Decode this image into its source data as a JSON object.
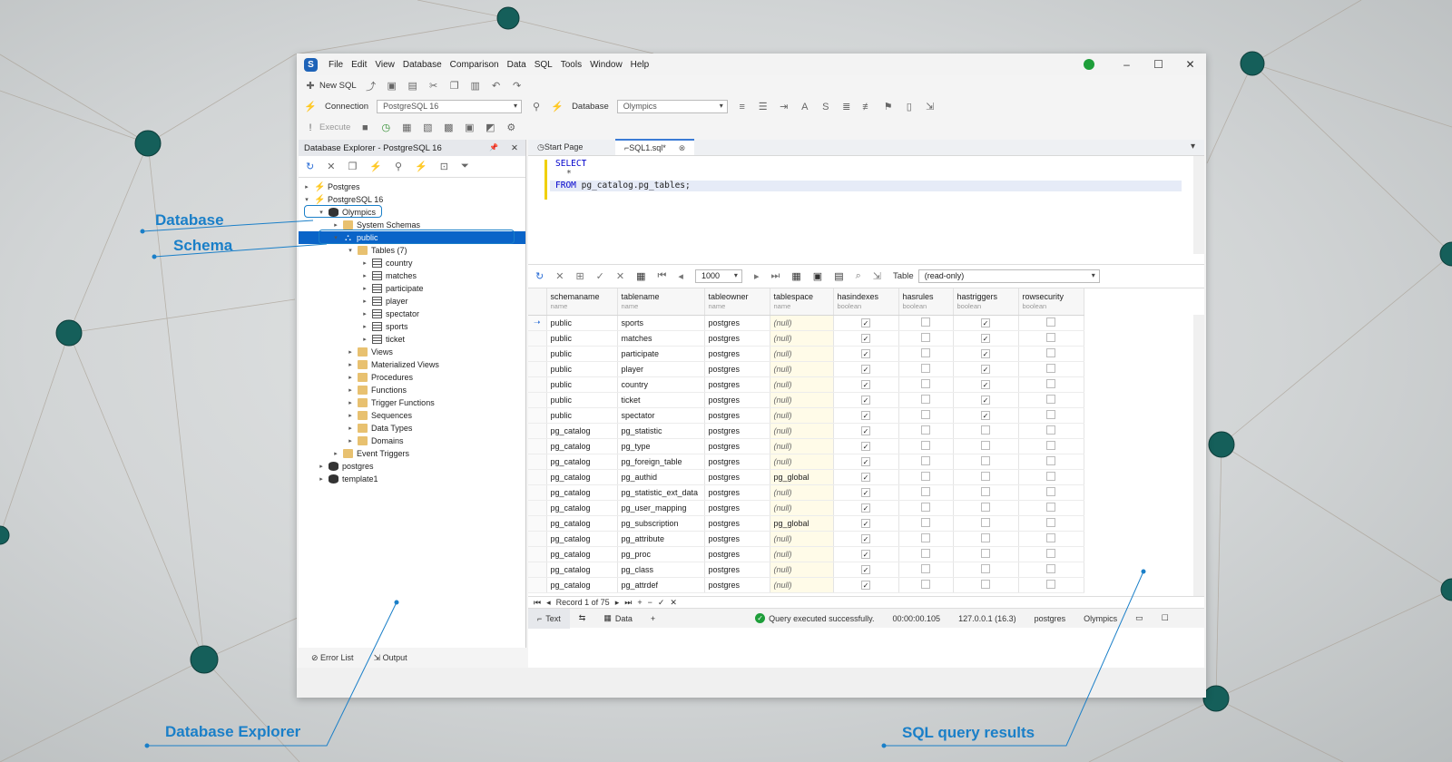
{
  "menu": [
    "File",
    "Edit",
    "View",
    "Database",
    "Comparison",
    "Data",
    "SQL",
    "Tools",
    "Window",
    "Help"
  ],
  "window_controls": [
    "–",
    "☐",
    "✕"
  ],
  "toolbar": {
    "new_sql": "New SQL",
    "connection_label": "Connection",
    "connection_value": "PostgreSQL 16",
    "database_label": "Database",
    "database_value": "Olympics",
    "execute": "Execute"
  },
  "explorer": {
    "title": "Database Explorer - PostgreSQL 16",
    "pin": "📌",
    "close": "✕"
  },
  "tree": [
    {
      "label": "Postgres",
      "level": 0,
      "icon": "plug",
      "arrow": "▸"
    },
    {
      "label": "PostgreSQL 16",
      "level": 0,
      "icon": "plug",
      "arrow": "▾"
    },
    {
      "label": "Olympics",
      "level": 1,
      "icon": "db",
      "arrow": "▾"
    },
    {
      "label": "System Schemas",
      "level": 2,
      "icon": "fold",
      "arrow": "▸"
    },
    {
      "label": "public",
      "level": 2,
      "icon": "schema",
      "arrow": "▾",
      "selected": true
    },
    {
      "label": "Tables (7)",
      "level": 3,
      "icon": "fold",
      "arrow": "▾"
    },
    {
      "label": "country",
      "level": 4,
      "icon": "tbl",
      "arrow": "▸"
    },
    {
      "label": "matches",
      "level": 4,
      "icon": "tbl",
      "arrow": "▸"
    },
    {
      "label": "participate",
      "level": 4,
      "icon": "tbl",
      "arrow": "▸"
    },
    {
      "label": "player",
      "level": 4,
      "icon": "tbl",
      "arrow": "▸"
    },
    {
      "label": "spectator",
      "level": 4,
      "icon": "tbl",
      "arrow": "▸"
    },
    {
      "label": "sports",
      "level": 4,
      "icon": "tbl",
      "arrow": "▸"
    },
    {
      "label": "ticket",
      "level": 4,
      "icon": "tbl",
      "arrow": "▸"
    },
    {
      "label": "Views",
      "level": 3,
      "icon": "fold",
      "arrow": "▸"
    },
    {
      "label": "Materialized Views",
      "level": 3,
      "icon": "fold",
      "arrow": "▸"
    },
    {
      "label": "Procedures",
      "level": 3,
      "icon": "fold",
      "arrow": "▸"
    },
    {
      "label": "Functions",
      "level": 3,
      "icon": "fold",
      "arrow": "▸"
    },
    {
      "label": "Trigger Functions",
      "level": 3,
      "icon": "fold",
      "arrow": "▸"
    },
    {
      "label": "Sequences",
      "level": 3,
      "icon": "fold",
      "arrow": "▸"
    },
    {
      "label": "Data Types",
      "level": 3,
      "icon": "fold",
      "arrow": "▸"
    },
    {
      "label": "Domains",
      "level": 3,
      "icon": "fold",
      "arrow": "▸"
    },
    {
      "label": "Event Triggers",
      "level": 2,
      "icon": "fold",
      "arrow": "▸"
    },
    {
      "label": "postgres",
      "level": 1,
      "icon": "db",
      "arrow": "▸"
    },
    {
      "label": "template1",
      "level": 1,
      "icon": "db",
      "arrow": "▸"
    }
  ],
  "bottom_tabs": {
    "error_list": "Error List",
    "output": "Output"
  },
  "tabs": {
    "start": "Start Page",
    "sql": "SQL1.sql*"
  },
  "editor": {
    "l1": "SELECT",
    "l2": "*",
    "l3_kw": "FROM",
    "l3_rest": "pg_catalog.pg_tables;"
  },
  "results_toolbar": {
    "limit": "1000",
    "table_label": "Table",
    "table_value": "(read-only)"
  },
  "columns": [
    {
      "name": "schemaname",
      "type": "name"
    },
    {
      "name": "tablename",
      "type": "name"
    },
    {
      "name": "tableowner",
      "type": "name"
    },
    {
      "name": "tablespace",
      "type": "name"
    },
    {
      "name": "hasindexes",
      "type": "boolean"
    },
    {
      "name": "hasrules",
      "type": "boolean"
    },
    {
      "name": "hastriggers",
      "type": "boolean"
    },
    {
      "name": "rowsecurity",
      "type": "boolean"
    }
  ],
  "rows": [
    [
      "public",
      "sports",
      "postgres",
      "(null)",
      1,
      0,
      1,
      0
    ],
    [
      "public",
      "matches",
      "postgres",
      "(null)",
      1,
      0,
      1,
      0
    ],
    [
      "public",
      "participate",
      "postgres",
      "(null)",
      1,
      0,
      1,
      0
    ],
    [
      "public",
      "player",
      "postgres",
      "(null)",
      1,
      0,
      1,
      0
    ],
    [
      "public",
      "country",
      "postgres",
      "(null)",
      1,
      0,
      1,
      0
    ],
    [
      "public",
      "ticket",
      "postgres",
      "(null)",
      1,
      0,
      1,
      0
    ],
    [
      "public",
      "spectator",
      "postgres",
      "(null)",
      1,
      0,
      1,
      0
    ],
    [
      "pg_catalog",
      "pg_statistic",
      "postgres",
      "(null)",
      1,
      0,
      0,
      0
    ],
    [
      "pg_catalog",
      "pg_type",
      "postgres",
      "(null)",
      1,
      0,
      0,
      0
    ],
    [
      "pg_catalog",
      "pg_foreign_table",
      "postgres",
      "(null)",
      1,
      0,
      0,
      0
    ],
    [
      "pg_catalog",
      "pg_authid",
      "postgres",
      "pg_global",
      1,
      0,
      0,
      0
    ],
    [
      "pg_catalog",
      "pg_statistic_ext_data",
      "postgres",
      "(null)",
      1,
      0,
      0,
      0
    ],
    [
      "pg_catalog",
      "pg_user_mapping",
      "postgres",
      "(null)",
      1,
      0,
      0,
      0
    ],
    [
      "pg_catalog",
      "pg_subscription",
      "postgres",
      "pg_global",
      1,
      0,
      0,
      0
    ],
    [
      "pg_catalog",
      "pg_attribute",
      "postgres",
      "(null)",
      1,
      0,
      0,
      0
    ],
    [
      "pg_catalog",
      "pg_proc",
      "postgres",
      "(null)",
      1,
      0,
      0,
      0
    ],
    [
      "pg_catalog",
      "pg_class",
      "postgres",
      "(null)",
      1,
      0,
      0,
      0
    ],
    [
      "pg_catalog",
      "pg_attrdef",
      "postgres",
      "(null)",
      1,
      0,
      0,
      0
    ]
  ],
  "record_nav": "Record 1 of 75",
  "status": {
    "text_tab": "Text",
    "data_tab": "Data",
    "message": "Query executed successfully.",
    "duration": "00:00:00.105",
    "server": "127.0.0.1 (16.3)",
    "user": "postgres",
    "database": "Olympics"
  },
  "callouts": {
    "database": "Database",
    "schema": "Schema",
    "explorer": "Database Explorer",
    "results": "SQL query results"
  },
  "colors": {
    "accent": "#1a7fc8",
    "selection": "#0a64c8"
  }
}
